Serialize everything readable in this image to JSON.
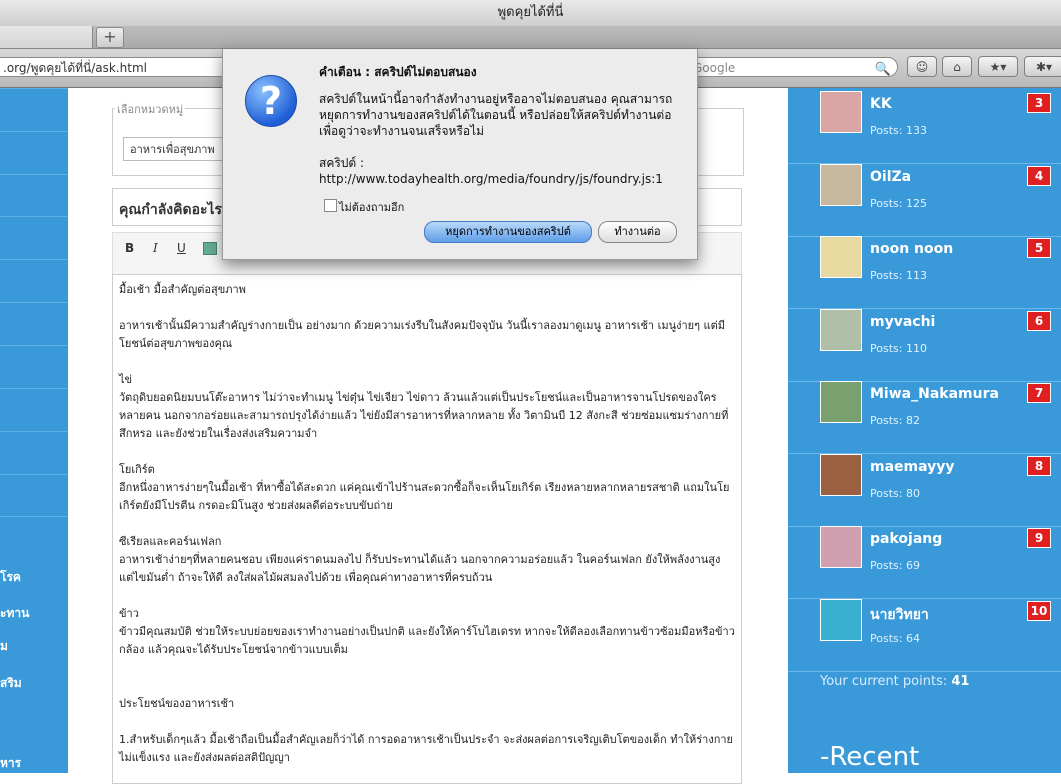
{
  "window": {
    "title": "พูดคุยได้ที่นี่"
  },
  "tabs": {
    "new_tab": "+"
  },
  "toolbar": {
    "url": ".org/พูดคุยได้ที่นี่/ask.html",
    "search_placeholder": "Google",
    "search_icon": "🔍"
  },
  "left_nav": {
    "items": [
      "โรค",
      "ะทาน",
      "ม",
      "สริม",
      "หาร"
    ]
  },
  "form": {
    "category_legend": "เลือกหมวดหมู่",
    "category_value": "อาหารเพื่อสุขภาพ",
    "title_text": "คุณกำลังคิดอะไร",
    "editor_buttons": [
      "B",
      "I",
      "U"
    ],
    "body": [
      "มื้อเช้า มื้อสำคัญต่อสุขภาพ",
      "",
      "อาหารเช้านั้นมีความสำคัญร่างกายเป็น อย่างมาก ด้วยความเร่งรีบในสังคมปัจจุบัน วันนี้เราลองมาดูเมนู อาหารเช้า เมนูง่ายๆ แต่มีโยชน์ต่อสุขภาพของคุณ",
      "",
      "ไข่",
      "วัตถุดิบยอดนิยมบนโต๊ะอาหาร ไม่ว่าจะทำเมนู ไข่ตุ๋น ไข่เจียว ไข่ดาว ล้วนแล้วแต่เป็นประโยชน์และเป็นอาหารจานโปรดของใครหลายคน นอกจากอร่อยและสามารถปรุงได้ง่ายแล้ว ไข่ยังมีสารอาหารที่หลากหลาย ทั้ง วิตามินบี 12 สังกะสี ช่วยซ่อมแซมร่างกายที่สึกหรอ และยังช่วยในเรื่องส่งเสริมความจำ",
      "",
      "โยเกิร์ต",
      "อีกหนึ่งอาหารง่ายๆในมื้อเช้า ที่หาซื้อได้สะดวก แค่คุณเข้าไปร้านสะดวกซื้อก็จะเห็นโยเกิร์ต เรียงหลายหลากหลายรสชาติ แถมในโยเกิร์ตยังมีโปรตีน กรดอะมิโนสูง ช่วยส่งผลดีต่อระบบขับถ่าย",
      "",
      "ซีเรียลและคอร์นเฟลก",
      "อาหารเช้าง่ายๆที่หลายคนชอบ เพียงแค่ราดนมลงไป ก็รับประทานได้แล้ว นอกจากความอร่อยแล้ว ในคอร์นเฟลก ยังให้พลังงานสูง แต่ไขมันต่ำ ถ้าจะให้ดี ลงใส่ผลไม้ผสมลงไปด้วย เพื่อคุณค่าทางอาหารที่ครบถ้วน",
      "",
      "ข้าว",
      "ข้าวมีคุณสมบัติ ช่วยให้ระบบย่อยของเราทำงานอย่างเป็นปกติ และยังให้คาร์โบไฮเดรท หากจะให้ดีลองเลือกทานข้าวซ้อมมือหรือข้าวกล้อง แล้วคุณจะได้รับประโยชน์จากข้าวแบบเต็ม",
      "",
      "",
      "ประโยชน์ของอาหารเช้า",
      "",
      "1.สำหรับเด็กๆแล้ว มื้อเช้าถือเป็นมื้อสำคัญเลยก็ว่าได้ การอดอาหารเช้าเป็นประจำ จะส่งผลต่อการเจริญเติบโตของเด็ก ทำให้ร่างกายไม่แข็งแรง และยังส่งผลต่อสติปัญญา"
    ]
  },
  "leaderboard": {
    "users": [
      {
        "name": "KK",
        "posts": "Posts: 133",
        "rank": "3",
        "avatar_color": "#d9a5a5"
      },
      {
        "name": "OilZa",
        "posts": "Posts: 125",
        "rank": "4",
        "avatar_color": "#c9b8a0"
      },
      {
        "name": "noon noon",
        "posts": "Posts: 113",
        "rank": "5",
        "avatar_color": "#e8d9a0"
      },
      {
        "name": "myvachi",
        "posts": "Posts: 110",
        "rank": "6",
        "avatar_color": "#b0c0a8"
      },
      {
        "name": "Miwa_Nakamura",
        "posts": "Posts: 82",
        "rank": "7",
        "avatar_color": "#7aa070"
      },
      {
        "name": "maemayyy",
        "posts": "Posts: 80",
        "rank": "8",
        "avatar_color": "#9a6040"
      },
      {
        "name": "pakojang",
        "posts": "Posts: 69",
        "rank": "9",
        "avatar_color": "#d0a0b0"
      },
      {
        "name": "นายวิทยา",
        "posts": "Posts: 64",
        "rank": "10",
        "avatar_color": "#3ab0d0"
      }
    ],
    "points_label": "Your current points:",
    "points_value": "41",
    "recent_heading": "-Recent"
  },
  "dialog": {
    "title": "คำเตือน : สคริปต์ไม่ตอบสนอง",
    "message": "สคริปต์ในหน้านี้อาจกำลังทำงานอยู่หรืออาจไม่ตอบสนอง คุณสามารถหยุดการทำงานของสคริปต์ได้ในตอนนี้ หรือปล่อยให้สคริปต์ทำงานต่อเพื่อดูว่าจะทำงานจนเสร็จหรือไม่",
    "script_label": "สคริปต์ : http://www.todayhealth.org/media/foundry/js/foundry.js:1",
    "checkbox_label": "ไม่ต้องถามอีก",
    "stop_button": "หยุดการทำงานของสคริปต์",
    "continue_button": "ทำงานต่อ"
  }
}
